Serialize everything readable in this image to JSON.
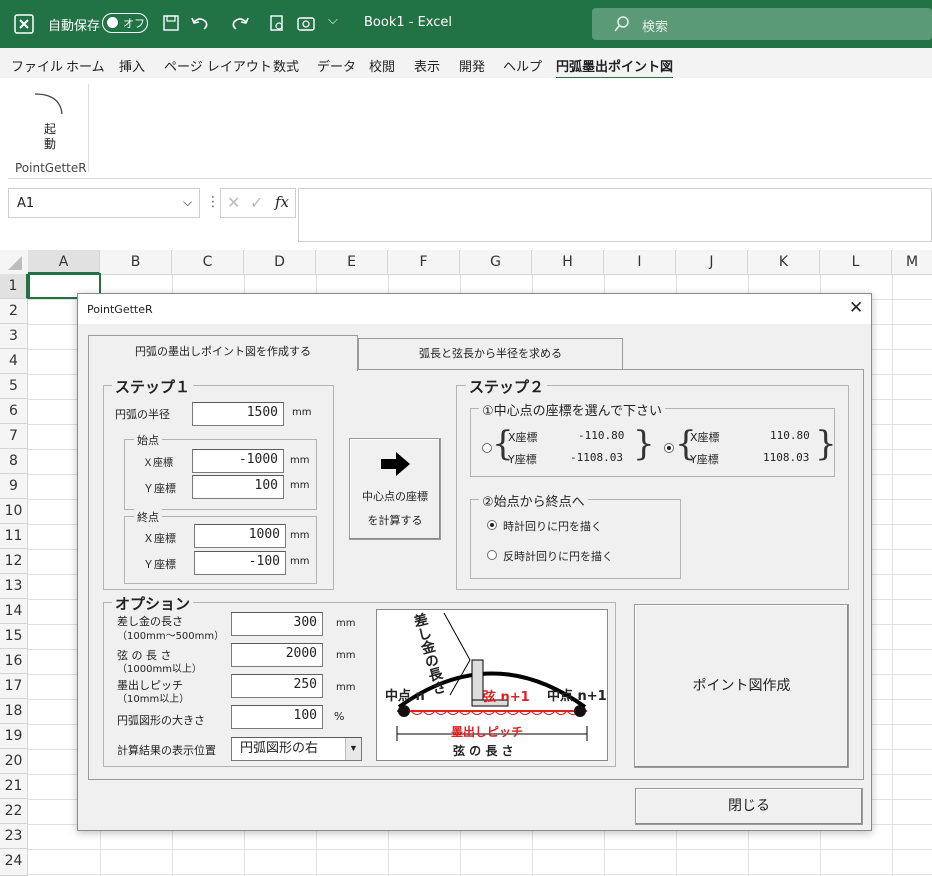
{
  "titlebar": {
    "autosave_label": "自動保存",
    "autosave_state": "オフ",
    "doc_title": "Book1  -  Excel",
    "search_placeholder": "検索"
  },
  "menu": [
    "ファイル",
    "ホーム",
    "挿入",
    "ページ レイアウト",
    "数式",
    "データ",
    "校閲",
    "表示",
    "開発",
    "ヘルプ",
    "円弧墨出ポイント図"
  ],
  "ribbon": {
    "launch_line1": "起",
    "launch_line2": "動",
    "group_label": "PointGetteR"
  },
  "formula": {
    "namebox": "A1",
    "fx": "fx"
  },
  "grid": {
    "columns": [
      "A",
      "B",
      "C",
      "D",
      "E",
      "F",
      "G",
      "H",
      "I",
      "J",
      "K",
      "L",
      "M"
    ],
    "rows": [
      "1",
      "2",
      "3",
      "4",
      "5",
      "6",
      "7",
      "8",
      "9",
      "10",
      "11",
      "12",
      "13",
      "14",
      "15",
      "16",
      "17",
      "18",
      "19",
      "20",
      "21",
      "22",
      "23",
      "24"
    ]
  },
  "dialog": {
    "title": "PointGetteR",
    "tabs": [
      "円弧の墨出しポイント図を作成する",
      "弧長と弦長から半径を求める"
    ],
    "step1": {
      "title": "ステップ１",
      "radius_label": "円弧の半径",
      "radius_value": "1500",
      "unit": "mm",
      "start_title": "始点",
      "start_x_label": "Ｘ座標",
      "start_x": "-1000",
      "start_y_label": "Ｙ座標",
      "start_y": "100",
      "end_title": "終点",
      "end_x_label": "Ｘ座標",
      "end_x": "1000",
      "end_y_label": "Ｙ座標",
      "end_y": "-100"
    },
    "calc_button": {
      "line1": "中心点の座標",
      "line2": "を計算する"
    },
    "step2": {
      "title": "ステップ２",
      "center_title": "①中心点の座標を選んで下さい",
      "opt1": {
        "x_label": "X座標",
        "x": "-110.80",
        "y_label": "Y座標",
        "y": "-1108.03"
      },
      "opt2": {
        "x_label": "X座標",
        "x": "110.80",
        "y_label": "Y座標",
        "y": "1108.03"
      },
      "direction_title": "②始点から終点へ",
      "cw_label": "時計回りに円を描く",
      "ccw_label": "反時計回りに円を描く"
    },
    "options": {
      "title": "オプション",
      "square_label": "差し金の長さ",
      "square_sub": "（100mm〜500mm）",
      "square_value": "300",
      "chord_label": "弦 の 長 さ",
      "chord_sub": "（1000mm以上）",
      "chord_value": "2000",
      "pitch_label": "墨出しピッチ",
      "pitch_sub": "（10mm以上）",
      "pitch_value": "250",
      "size_label": "円弧図形の大きさ",
      "size_value": "100",
      "percent": "%",
      "position_label": "計算結果の表示位置",
      "position_value": "円弧図形の右",
      "unit": "mm"
    },
    "diagram": {
      "square_text": "差し金の長さ",
      "midpoint_n": "中点 n",
      "chord_n1": "弦 n+1",
      "midpoint_n1": "中点 n+1",
      "pitch": "墨出しピッチ",
      "chord_length": "弦 の 長 さ",
      "red": "#e02020"
    },
    "create_button": "ポイント図作成",
    "close_button": "閉じる"
  }
}
